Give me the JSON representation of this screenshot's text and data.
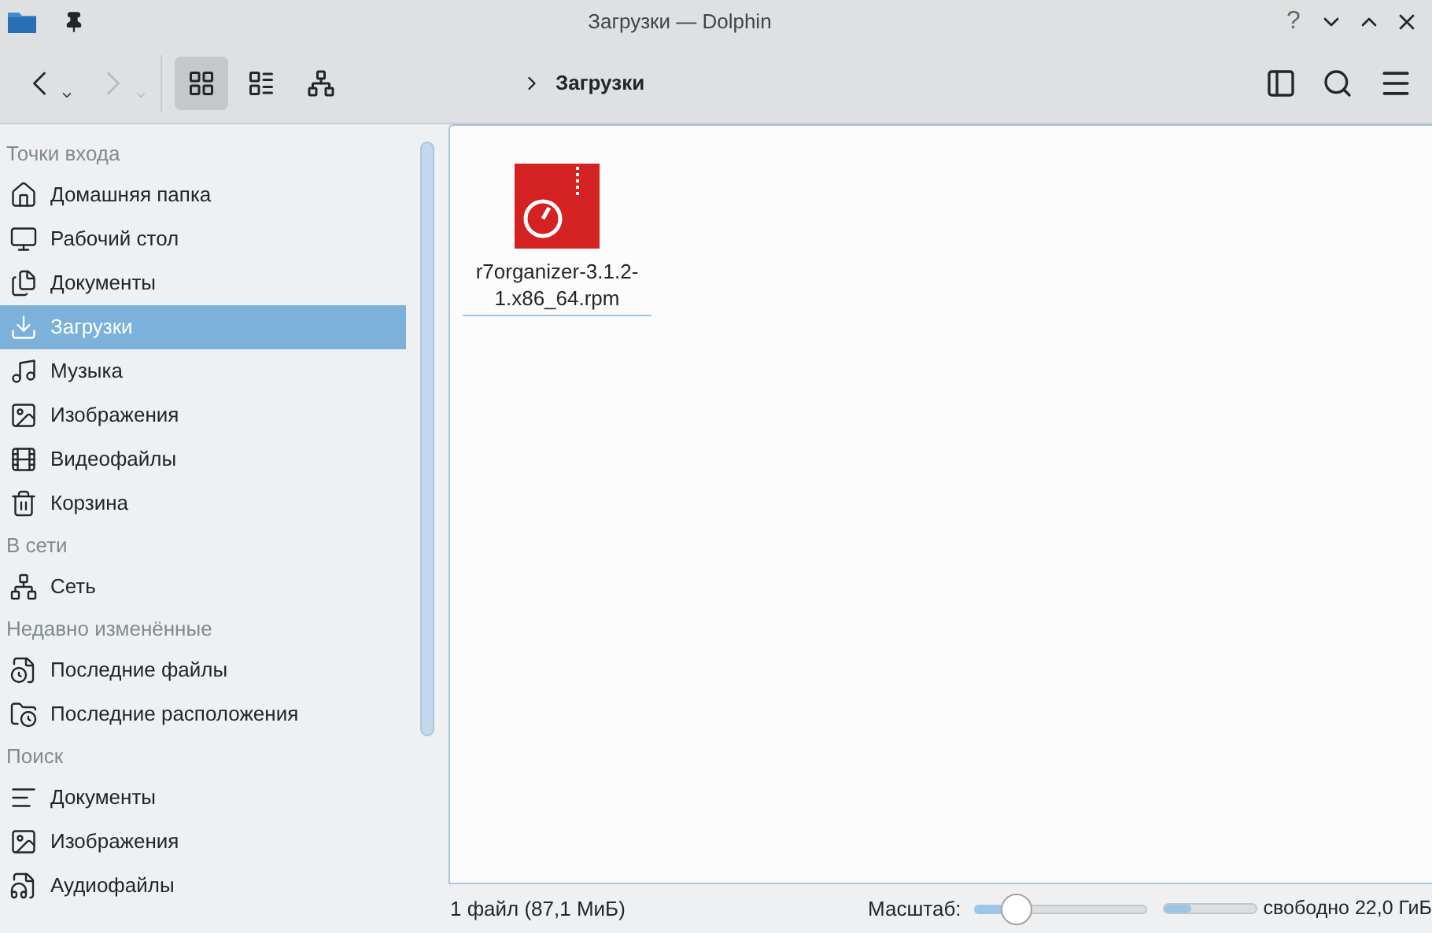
{
  "window": {
    "title": "Загрузки — Dolphin",
    "help": "?"
  },
  "toolbar": {
    "view_modes": [
      {
        "selected": true
      },
      {
        "selected": false
      },
      {
        "selected": false
      }
    ],
    "breadcrumb": "Загрузки"
  },
  "sidebar": {
    "sections": [
      {
        "title": "Точки входа",
        "items": [
          {
            "label": "Домашняя папка",
            "selected": false
          },
          {
            "label": "Рабочий стол",
            "selected": false
          },
          {
            "label": "Документы",
            "selected": false
          },
          {
            "label": "Загрузки",
            "selected": true
          },
          {
            "label": "Музыка",
            "selected": false
          },
          {
            "label": "Изображения",
            "selected": false
          },
          {
            "label": "Видеофайлы",
            "selected": false
          },
          {
            "label": "Корзина",
            "selected": false
          }
        ]
      },
      {
        "title": "В сети",
        "items": [
          {
            "label": "Сеть",
            "selected": false
          }
        ]
      },
      {
        "title": "Недавно изменённые",
        "items": [
          {
            "label": "Последние файлы",
            "selected": false
          },
          {
            "label": "Последние расположения",
            "selected": false
          }
        ]
      },
      {
        "title": "Поиск",
        "items": [
          {
            "label": "Документы",
            "selected": false
          },
          {
            "label": "Изображения",
            "selected": false
          },
          {
            "label": "Аудиофайлы",
            "selected": false
          }
        ]
      }
    ]
  },
  "files": [
    {
      "name": "r7organizer-3.1.2-1.x86_64.rpm",
      "selected": false
    }
  ],
  "status_bar": {
    "summary": "1 файл (87,1 МиБ)",
    "zoom_label": "Масштаб:",
    "zoom": {
      "level": 0.25
    },
    "disk": {
      "level": 0.3
    },
    "free_space": "свободно 22,0 ГиБ"
  }
}
